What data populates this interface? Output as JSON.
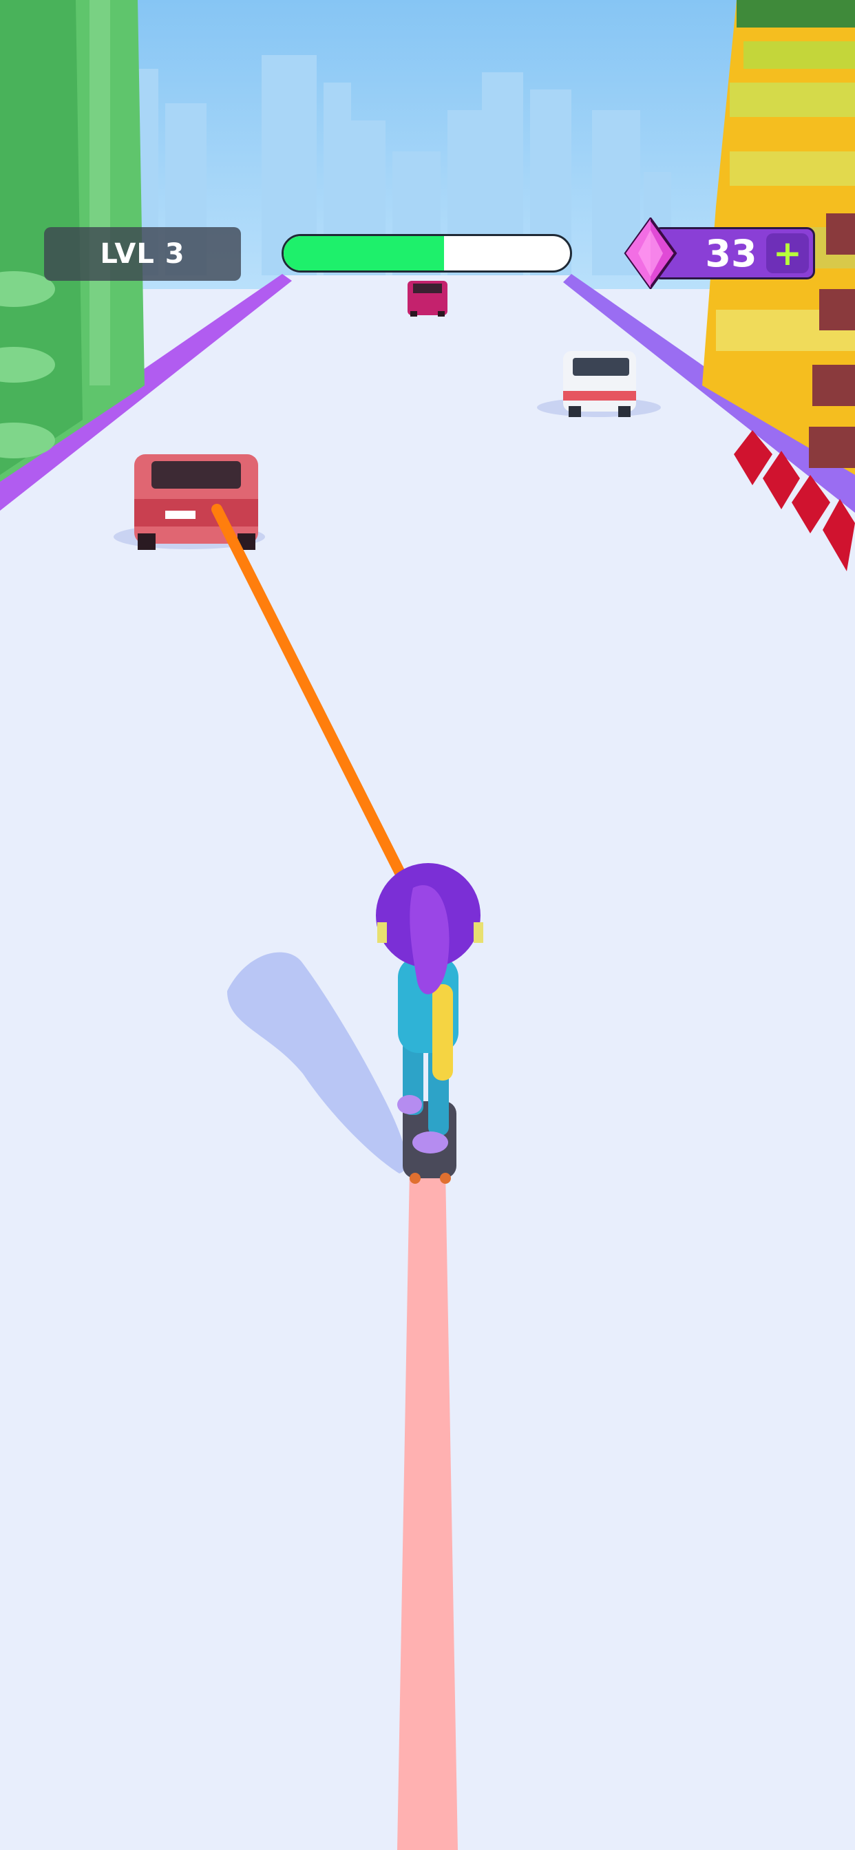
{
  "hud": {
    "level_label": "LVL 3",
    "progress": 0.56,
    "gems": "33",
    "add_gems_symbol": "+"
  },
  "icons": {
    "gem": "gem-icon",
    "add": "plus-icon"
  },
  "colors": {
    "sky": "#8cc9f5",
    "road": "#e8eefc",
    "rail": "#b15cf0",
    "progress": "#1ef06b",
    "gem_panel": "#8a3fd6",
    "plus": "#b8ff3a",
    "grapple": "#ff7e0d",
    "trail": "#ffb1b1"
  }
}
